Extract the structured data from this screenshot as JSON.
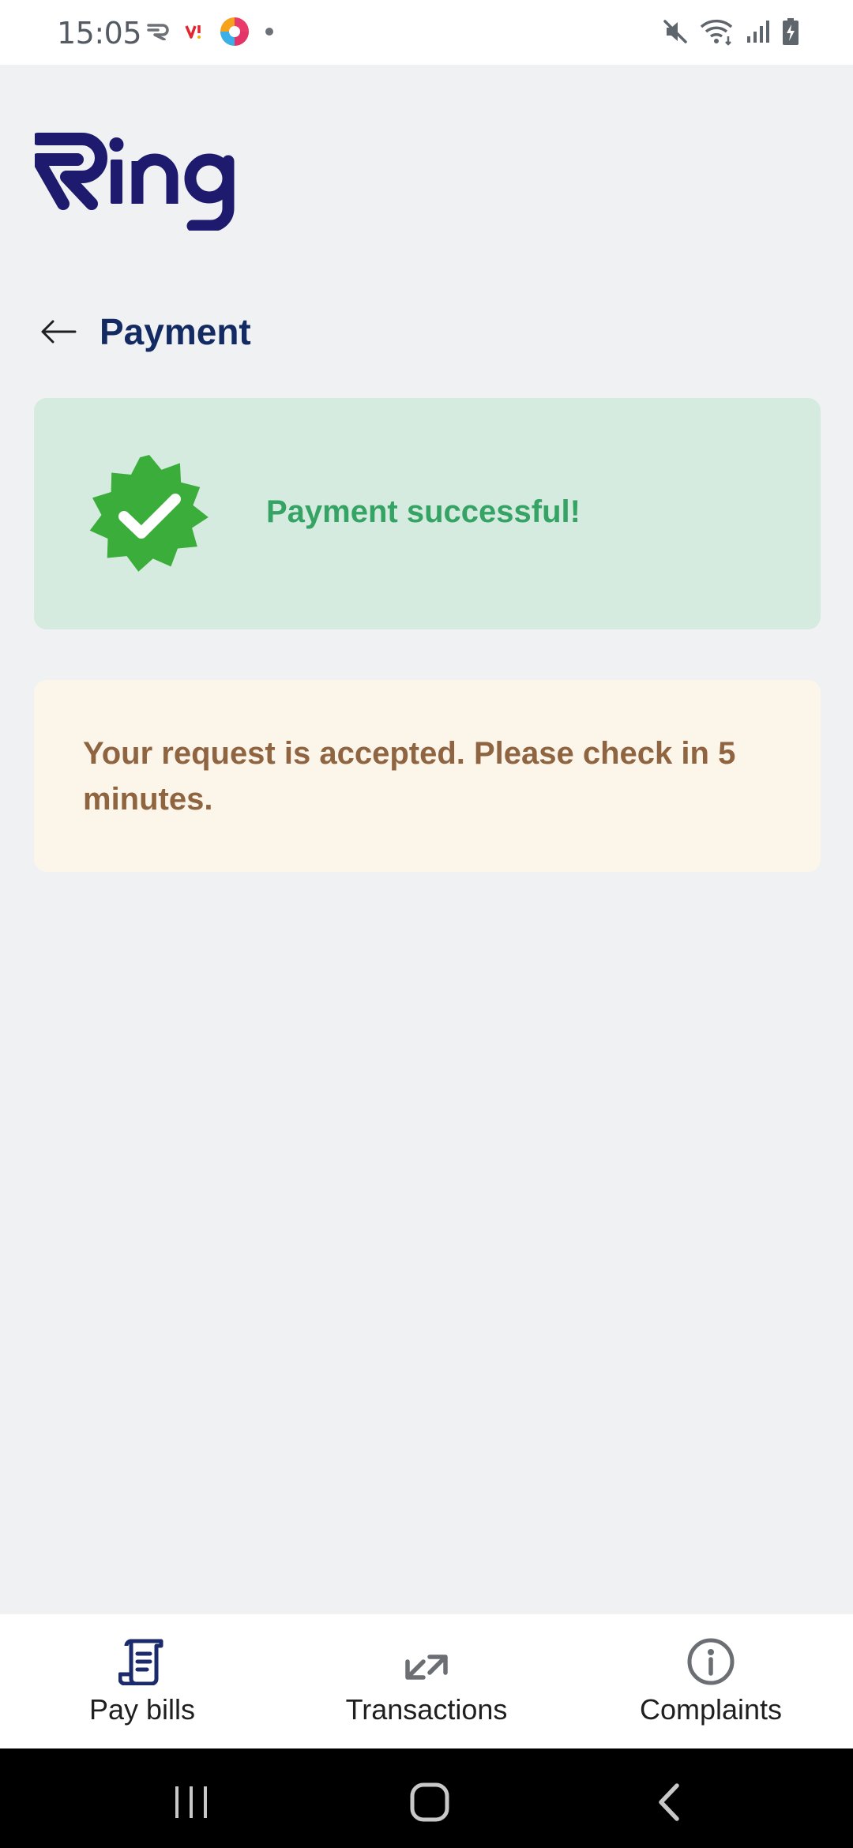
{
  "status_bar": {
    "time": "15:05",
    "left_icons": [
      "ring-app-icon",
      "vi-carrier-icon",
      "colorful-app-icon",
      "dot-icon"
    ],
    "right_icons": [
      "mute-icon",
      "wifi-icon",
      "signal-icon",
      "battery-icon"
    ]
  },
  "app": {
    "logo_text": "Ring",
    "brand_color": "#1e1a6e"
  },
  "header": {
    "title": "Payment"
  },
  "success": {
    "message": "Payment successful!",
    "color": "#35a363",
    "badge_color": "#3aad3a"
  },
  "notice": {
    "message": "Your request is accepted. Please check in 5 minutes.",
    "color": "#8f6440"
  },
  "bottom_nav": {
    "items": [
      {
        "label": "Pay bills",
        "icon": "bill-icon",
        "active": true
      },
      {
        "label": "Transactions",
        "icon": "transactions-arrows-icon",
        "active": false
      },
      {
        "label": "Complaints",
        "icon": "info-icon",
        "active": false
      }
    ]
  },
  "system_nav": [
    "recents-button",
    "home-button",
    "back-button"
  ]
}
